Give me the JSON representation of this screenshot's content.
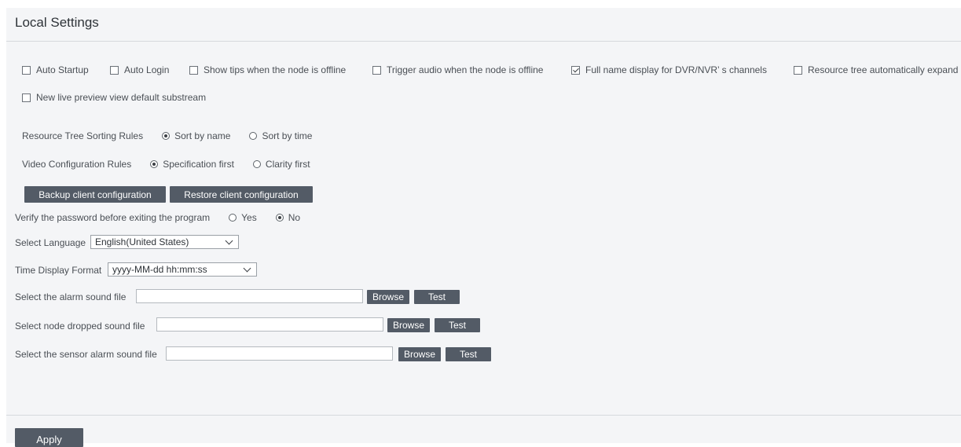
{
  "page": {
    "title": "Local Settings"
  },
  "options": [
    {
      "label": "Auto Startup",
      "checked": false
    },
    {
      "label": "Auto Login",
      "checked": false
    },
    {
      "label": "Show tips when the node is offline",
      "checked": false
    },
    {
      "label": "Trigger audio when the node is offline",
      "checked": false
    },
    {
      "label": "Full name display for DVR/NVR’ s channels",
      "checked": true
    },
    {
      "label": "Resource tree automatically expand",
      "checked": false
    },
    {
      "label": "New live preview view default substream",
      "checked": false
    }
  ],
  "sorting": {
    "label": "Resource Tree Sorting Rules",
    "options": [
      {
        "label": "Sort by name",
        "selected": true
      },
      {
        "label": "Sort by time",
        "selected": false
      }
    ]
  },
  "video_config": {
    "label": "Video Configuration Rules",
    "options": [
      {
        "label": "Specification first",
        "selected": true
      },
      {
        "label": "Clarity first",
        "selected": false
      }
    ]
  },
  "buttons": {
    "backup": "Backup client configuration",
    "restore": "Restore client configuration",
    "browse": "Browse",
    "test": "Test",
    "apply": "Apply"
  },
  "verify_password": {
    "label": "Verify the password before exiting the program",
    "options": [
      {
        "label": "Yes",
        "selected": false
      },
      {
        "label": "No",
        "selected": true
      }
    ]
  },
  "language": {
    "label": "Select Language",
    "value": "English(United States)"
  },
  "time_format": {
    "label": "Time Display Format",
    "value": "yyyy-MM-dd hh:mm:ss"
  },
  "sound_files": {
    "alarm": {
      "label": "Select the alarm sound file",
      "value": ""
    },
    "node_dropped": {
      "label": "Select node dropped sound file",
      "value": ""
    },
    "sensor_alarm": {
      "label": "Select the sensor alarm sound file",
      "value": ""
    }
  }
}
